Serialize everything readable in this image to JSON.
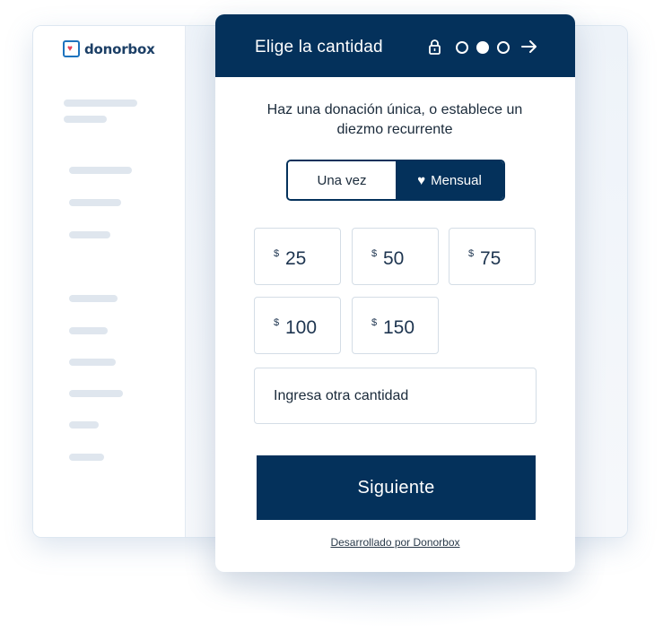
{
  "brand": {
    "name": "donorbox"
  },
  "header": {
    "title": "Elige la cantidad",
    "steps": [
      {
        "state": "inactive"
      },
      {
        "state": "active"
      },
      {
        "state": "inactive"
      }
    ]
  },
  "form": {
    "subtitle": "Haz una donación única, o establece un diezmo recurrente",
    "frequency": {
      "options": [
        {
          "label": "Una vez",
          "selected": false
        },
        {
          "label": "Mensual",
          "selected": true,
          "icon": "heart-icon"
        }
      ]
    },
    "currency_symbol": "$",
    "amounts": [
      "25",
      "50",
      "75",
      "100",
      "150"
    ],
    "other_amount_placeholder": "Ingresa otra cantidad",
    "next_label": "Siguiente",
    "powered_by": "Desarrollado por Donorbox"
  },
  "colors": {
    "primary": "#04315b",
    "border": "#d4dde6",
    "logo_blue": "#1e73be",
    "logo_heart": "#e8425a"
  }
}
